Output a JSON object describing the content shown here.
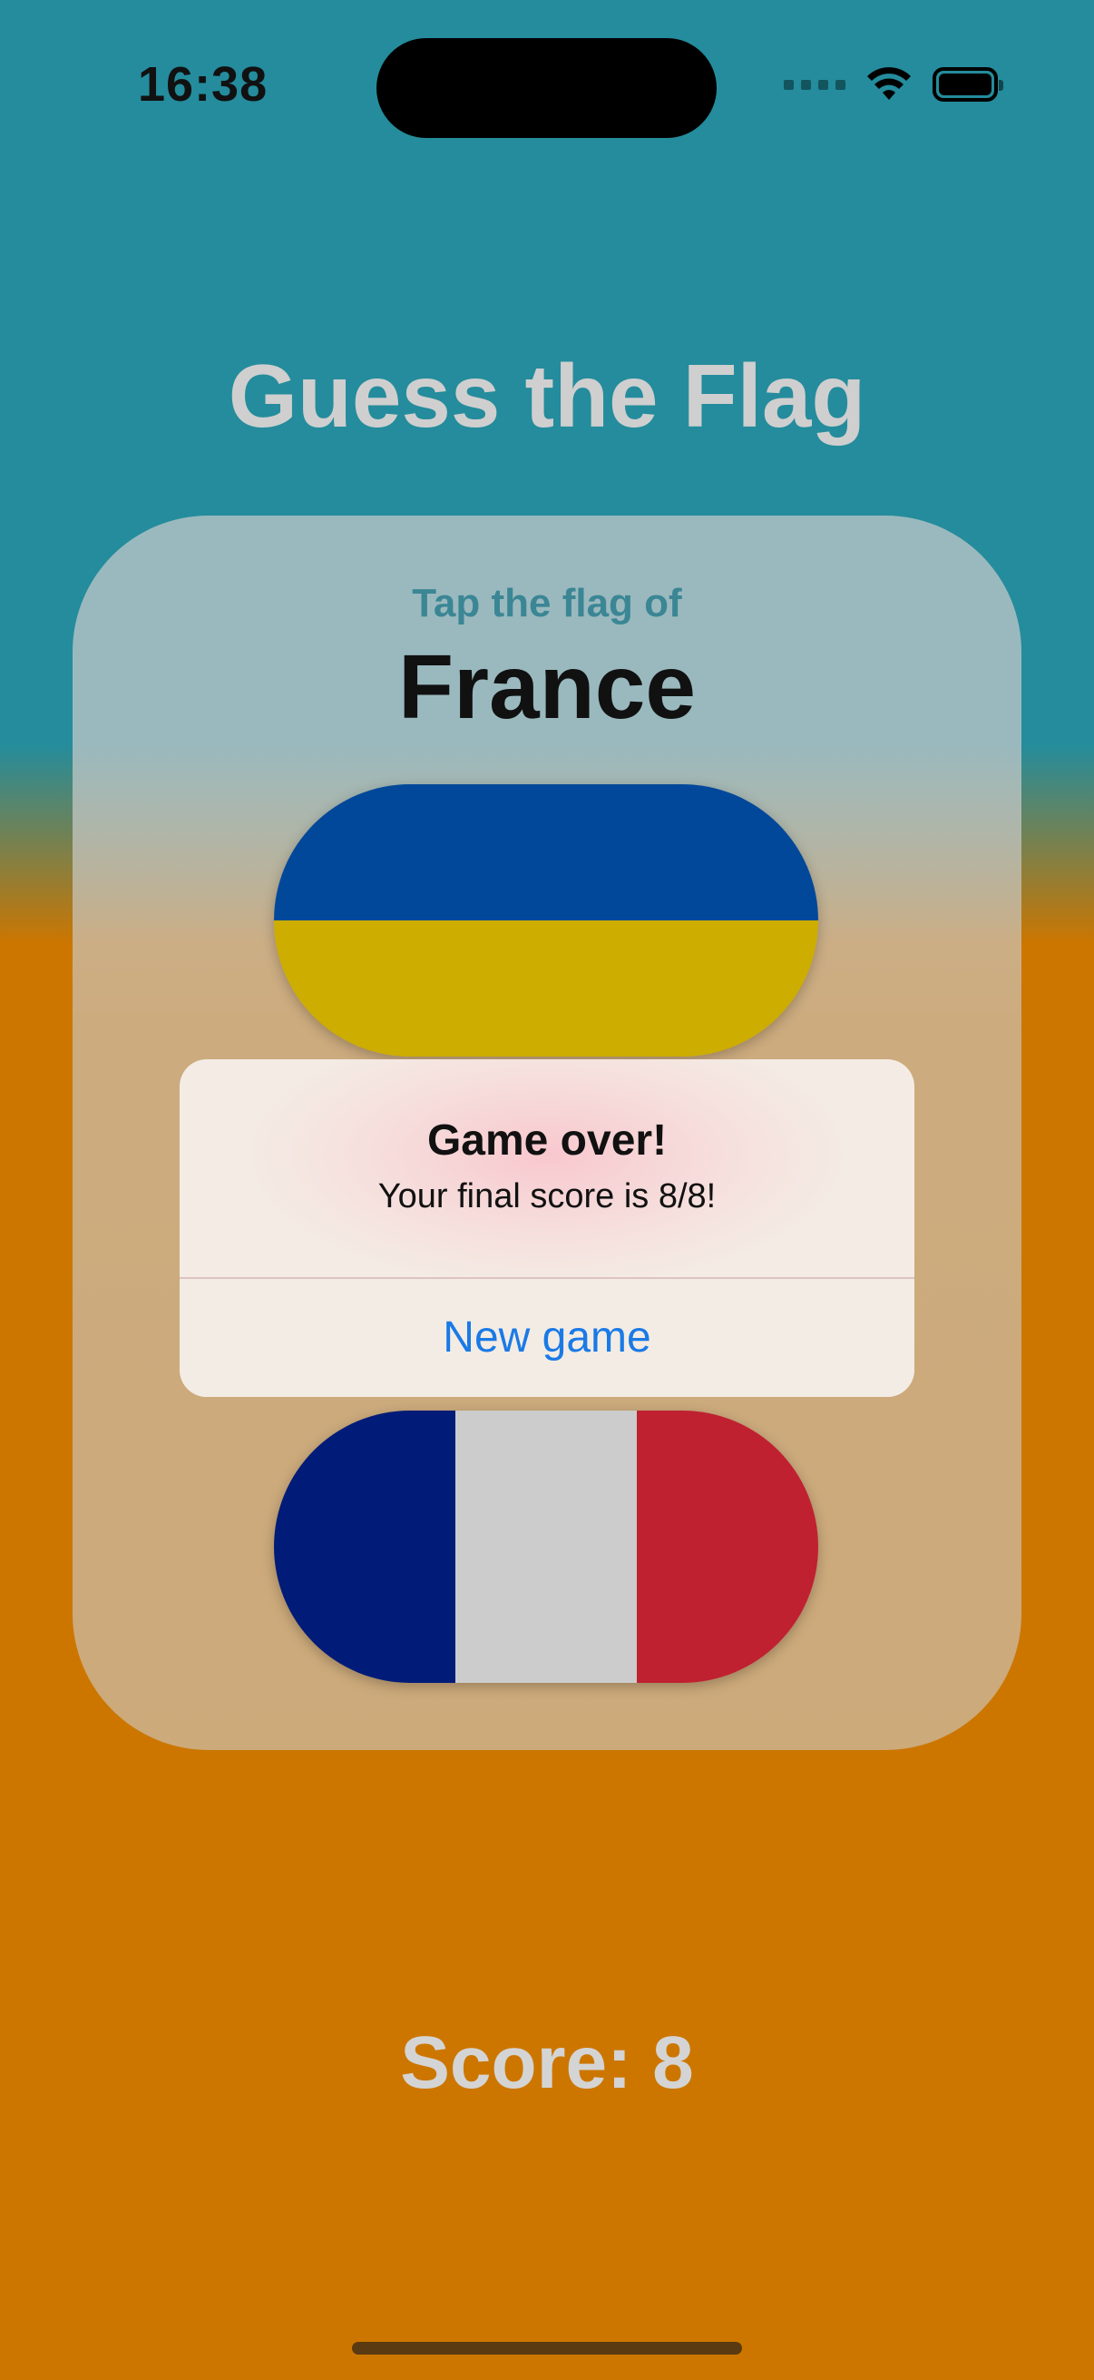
{
  "status_bar": {
    "time": "16:38"
  },
  "app": {
    "title": "Guess the Flag"
  },
  "question": {
    "prompt": "Tap the flag of",
    "country": "France"
  },
  "flags": [
    {
      "country": "Ukraine",
      "colors": [
        "#02489a",
        "#ccad00"
      ]
    },
    {
      "country": "France",
      "colors": [
        "#001b78",
        "#cccccc",
        "#bf2131"
      ]
    }
  ],
  "alert": {
    "title": "Game over!",
    "message": "Your final score is 8/8!",
    "button_label": "New game"
  },
  "score": {
    "label": "Score: 8"
  },
  "colors": {
    "background_top": "#248c9c",
    "background_bottom": "#cc7600",
    "accent_link": "#1a7ae6"
  }
}
